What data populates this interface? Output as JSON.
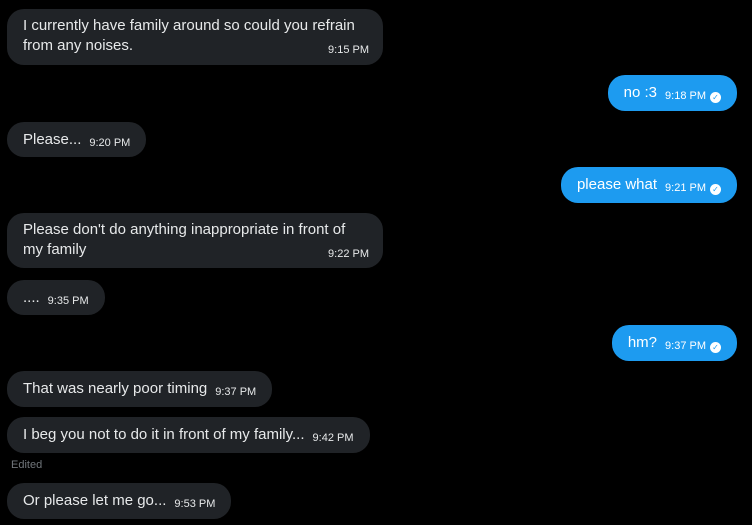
{
  "messages": [
    {
      "text": "I currently have family around so could you refrain from any noises.",
      "time": "9:15 PM"
    },
    {
      "text": "no :3",
      "time": "9:18 PM"
    },
    {
      "text": "Please...",
      "time": "9:20 PM"
    },
    {
      "text": "please what",
      "time": "9:21 PM"
    },
    {
      "text": "Please don't do anything inappropriate in front of my family",
      "time": "9:22 PM"
    },
    {
      "text": "....",
      "time": "9:35 PM"
    },
    {
      "text": "hm?",
      "time": "9:37 PM"
    },
    {
      "text": "That was nearly poor timing",
      "time": "9:37 PM"
    },
    {
      "text": "I beg you not to do it in front of my family...",
      "time": "9:42 PM"
    },
    {
      "text": "Or please let me go...",
      "time": "9:53 PM"
    }
  ],
  "edited_label": "Edited",
  "colors": {
    "incoming_bubble": "#202327",
    "outgoing_bubble": "#1d9bf0",
    "background": "#000000"
  },
  "icons": {
    "sent_check": "check-circle-icon"
  }
}
